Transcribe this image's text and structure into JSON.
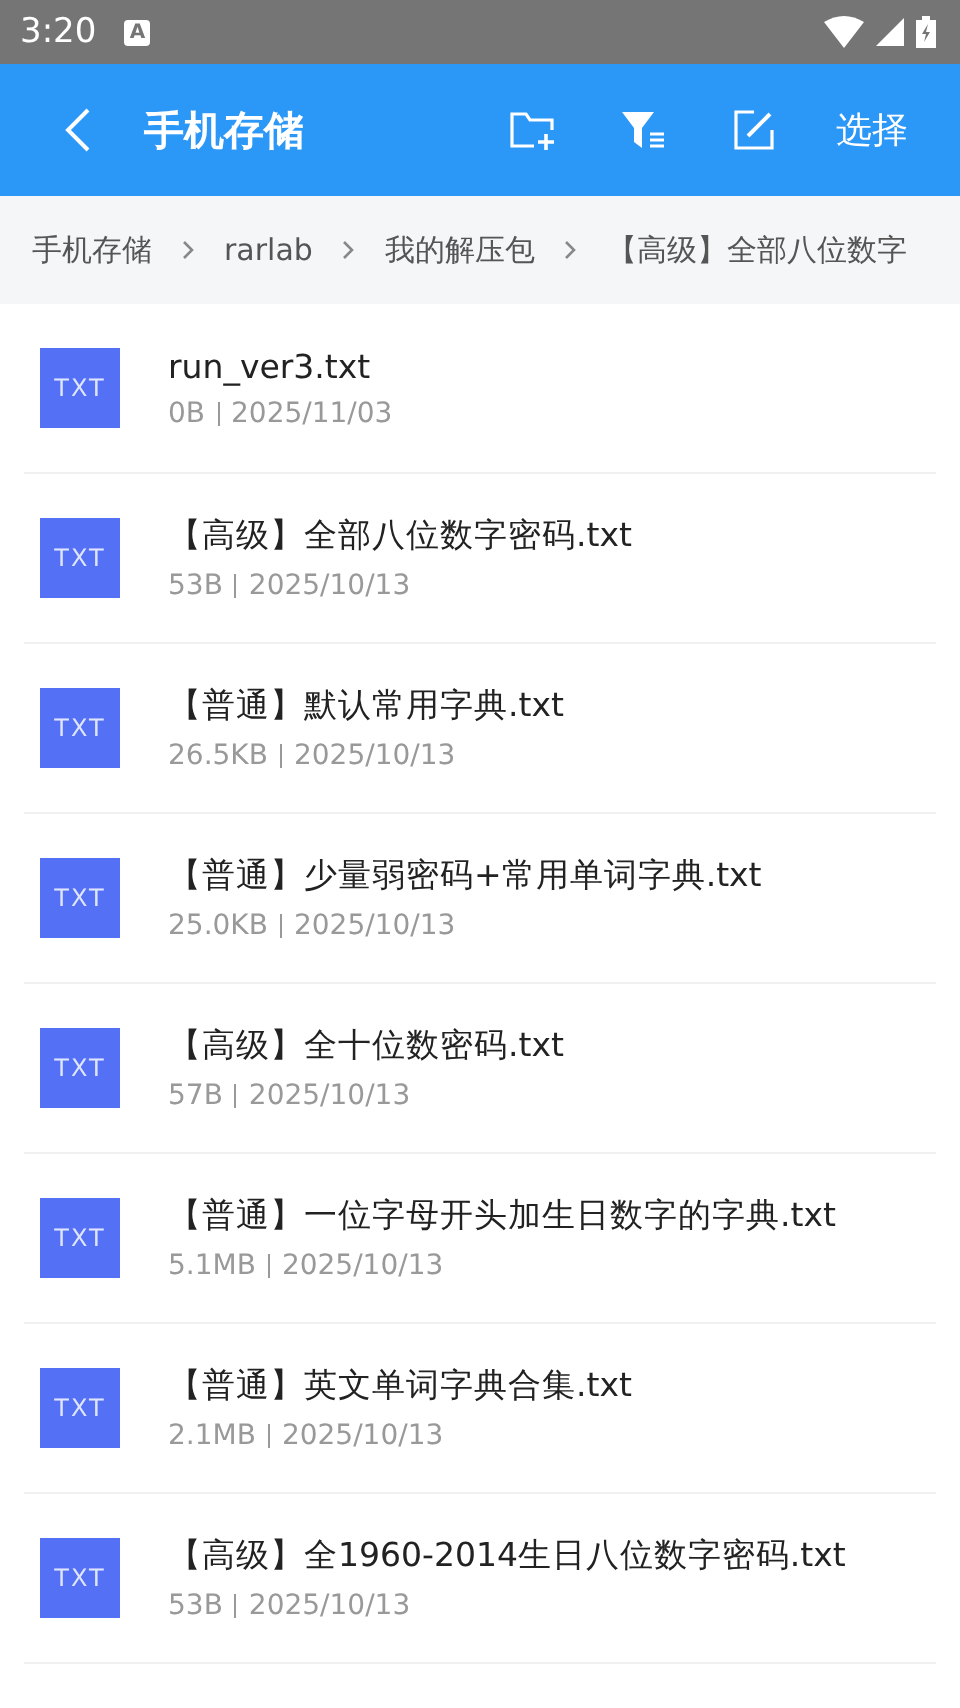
{
  "status_bar": {
    "time": "3:20",
    "notification_letter": "A"
  },
  "app_bar": {
    "title": "手机存储",
    "select_label": "选择"
  },
  "breadcrumb": [
    "手机存储",
    "rarlab",
    "我的解压包",
    "【高级】全部八位数字"
  ],
  "files": [
    {
      "type_label": "TXT",
      "name": "run_ver3.txt",
      "size": "0B",
      "date": "2025/11/03"
    },
    {
      "type_label": "TXT",
      "name": "【高级】全部八位数字密码.txt",
      "size": "53B",
      "date": "2025/10/13"
    },
    {
      "type_label": "TXT",
      "name": "【普通】默认常用字典.txt",
      "size": "26.5KB",
      "date": "2025/10/13"
    },
    {
      "type_label": "TXT",
      "name": "【普通】少量弱密码+常用单词字典.txt",
      "size": "25.0KB",
      "date": "2025/10/13"
    },
    {
      "type_label": "TXT",
      "name": "【高级】全十位数密码.txt",
      "size": "57B",
      "date": "2025/10/13"
    },
    {
      "type_label": "TXT",
      "name": "【普通】一位字母开头加生日数字的字典.txt",
      "size": "5.1MB",
      "date": "2025/10/13"
    },
    {
      "type_label": "TXT",
      "name": "【普通】英文单词字典合集.txt",
      "size": "2.1MB",
      "date": "2025/10/13"
    },
    {
      "type_label": "TXT",
      "name": "【高级】全1960-2014生日八位数字密码.txt",
      "size": "53B",
      "date": "2025/10/13"
    }
  ]
}
